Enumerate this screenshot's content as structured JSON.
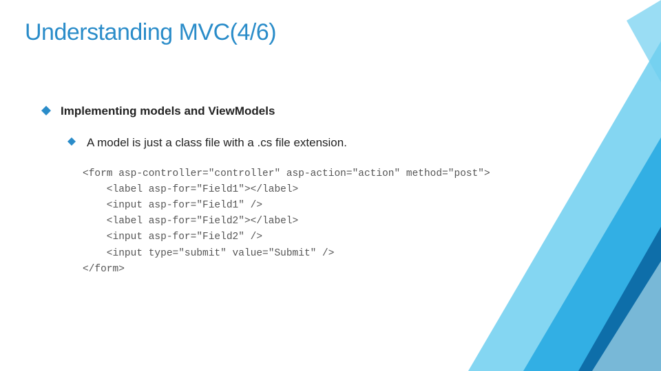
{
  "title": "Understanding MVC(4/6)",
  "bullets": {
    "main": "Implementing models and ViewModels",
    "sub": "A model is just a class file with a .cs file extension."
  },
  "code": "<form asp-controller=\"controller\" asp-action=\"action\" method=\"post\">\n    <label asp-for=\"Field1\"></label>\n    <input asp-for=\"Field1\" />\n    <label asp-for=\"Field2\"></label>\n    <input asp-for=\"Field2\" />\n    <input type=\"submit\" value=\"Submit\" />\n</form>",
  "colors": {
    "title": "#2a8cc9",
    "bullet": "#2a8cc9",
    "tri_light": "#6fcff0",
    "tri_mid": "#29abe2",
    "tri_dark": "#0d6aa5"
  }
}
